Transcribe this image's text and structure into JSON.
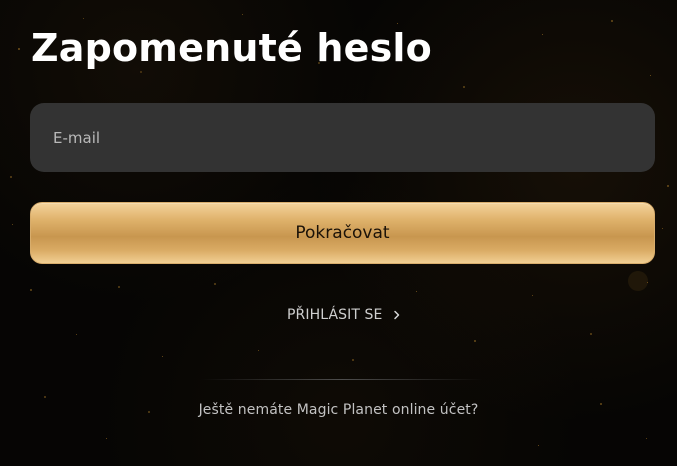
{
  "page": {
    "title": "Zapomenuté heslo"
  },
  "form": {
    "email_placeholder": "E-mail",
    "continue_label": "Pokračovat"
  },
  "links": {
    "login_label": "PŘIHLÁSIT SE",
    "login_icon": "chevron-right-icon"
  },
  "footer": {
    "text": "Ještě nemáte Magic Planet online účet?"
  },
  "colors": {
    "background": "#050404",
    "field_background": "#333333",
    "button_gold_light": "#f4d39b",
    "button_gold_dark": "#c8964f",
    "text_light": "#ffffff"
  }
}
